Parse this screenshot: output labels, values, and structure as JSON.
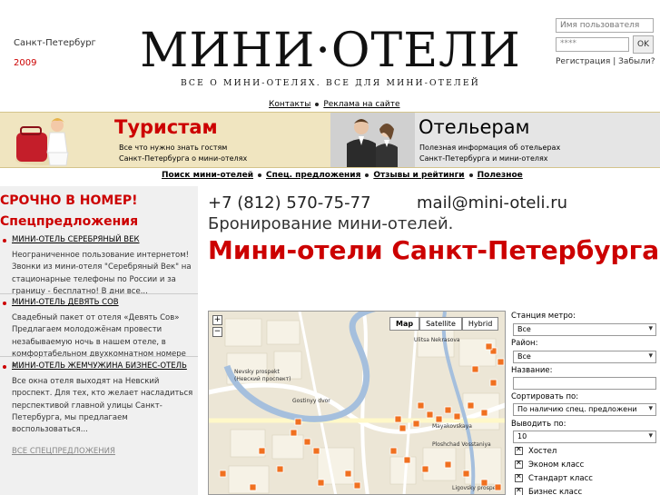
{
  "header": {
    "city": "Санкт-Петербург",
    "year": "2009",
    "logo_title": "МИНИ·ОТЕЛИ",
    "logo_subtitle": "ВСЕ О МИНИ-ОТЕЛЯХ. ВСЕ ДЛЯ МИНИ-ОТЕЛЕЙ"
  },
  "login": {
    "username_placeholder": "Имя пользователя",
    "password_value": "****",
    "ok_label": "OK",
    "register_link": "Регистрация",
    "separator": "|",
    "forgot_link": "Забыли?"
  },
  "topnav": {
    "contacts": "Контакты",
    "ads": "Реклама на сайте"
  },
  "banner": {
    "tourists_title": "Туристам",
    "tourists_desc_1": "Все что нужно знать гостям",
    "tourists_desc_2": "Санкт-Петербурга о мини-отелях",
    "hoteliers_title": "Отельерам",
    "hoteliers_desc_1": "Полезная информация об отельерах",
    "hoteliers_desc_2": "Санкт-Петербурга и мини-отелях"
  },
  "subnav": {
    "search": "Поиск мини-отелей",
    "offers": "Спец. предложения",
    "reviews": "Отзывы и рейтинги",
    "useful": "Полезное"
  },
  "sidebar": {
    "urgent": "СРОЧНО В НОМЕР!",
    "offers_heading": "Спецпредложения",
    "offers": [
      {
        "title": "МИНИ-ОТЕЛЬ СЕРЕБРЯНЫЙ ВЕК",
        "text": "Неограниченное пользование интернетом! Звонки из мини-отеля \"Серебряный Век\" на стационарные телефоны по России и за границу - бесплатно! В дни все..."
      },
      {
        "title": "МИНИ-ОТЕЛЬ ДЕВЯТЬ СОВ",
        "text": "Свадебный пакет от отеля «Девять Сов» Предлагаем молодожёнам провести незабываемую ночь в нашем отеле, в комфортабельном двухкомнатном номере к..."
      },
      {
        "title": "МИНИ-ОТЕЛЬ ЖЕМЧУЖИНА БИЗНЕС-ОТЕЛЬ",
        "text": "Все окна отеля выходят на Невский проспект. Для тех, кто желает насладиться перспективой главной улицы Санкт-Петербурга, мы предлагаем воспользоваться..."
      }
    ],
    "all_offers": "ВСЕ СПЕЦПРЕДЛОЖЕНИЯ"
  },
  "main": {
    "phone": "+7 (812) 570-75-77",
    "email": "mail@mini-oteli.ru",
    "booking": "Бронирование мини-отелей.",
    "title": "Мини-отели Санкт-Петербурга"
  },
  "map": {
    "types": [
      "Map",
      "Satellite",
      "Hybrid"
    ],
    "zoom_in": "+",
    "zoom_out": "−",
    "labels": {
      "nevsky": "Nevsky prospekt",
      "nevsky_ru": "(Невский проспект)",
      "gostinyy": "Gostinyy dvor",
      "nekrasova": "Ulitsa Nekrasova",
      "mayakovskaya": "Mayakovskaya",
      "vosstaniya": "Ploshchad Vosstaniya",
      "ligovsky": "Ligovsky prospekt"
    }
  },
  "filter": {
    "metro_label": "Станция метро:",
    "metro_value": "Все",
    "district_label": "Район:",
    "district_value": "Все",
    "name_label": "Название:",
    "sort_label": "Сортировать по:",
    "sort_value": "По наличию спец. предложени",
    "show_label": "Выводить по:",
    "show_value": "10",
    "classes": [
      "Хостел",
      "Эконом класс",
      "Стандарт класс",
      "Бизнес класс"
    ]
  },
  "colors": {
    "accent": "#cc0000",
    "banner_bg": "#f0e5c0",
    "sidebar_bg": "#f0f0f0",
    "map_marker": "#f07020"
  }
}
